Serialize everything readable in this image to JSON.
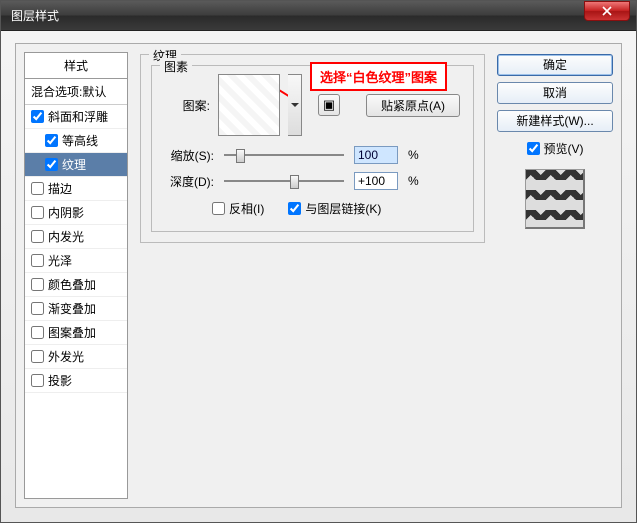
{
  "window": {
    "title": "图层样式"
  },
  "styles_panel": {
    "header": "样式",
    "blend_options": "混合选项:默认",
    "items": [
      {
        "label": "斜面和浮雕",
        "checked": true,
        "indent": false,
        "selected": false
      },
      {
        "label": "等高线",
        "checked": true,
        "indent": true,
        "selected": false
      },
      {
        "label": "纹理",
        "checked": true,
        "indent": true,
        "selected": true
      },
      {
        "label": "描边",
        "checked": false,
        "indent": false,
        "selected": false
      },
      {
        "label": "内阴影",
        "checked": false,
        "indent": false,
        "selected": false
      },
      {
        "label": "内发光",
        "checked": false,
        "indent": false,
        "selected": false
      },
      {
        "label": "光泽",
        "checked": false,
        "indent": false,
        "selected": false
      },
      {
        "label": "颜色叠加",
        "checked": false,
        "indent": false,
        "selected": false
      },
      {
        "label": "渐变叠加",
        "checked": false,
        "indent": false,
        "selected": false
      },
      {
        "label": "图案叠加",
        "checked": false,
        "indent": false,
        "selected": false
      },
      {
        "label": "外发光",
        "checked": false,
        "indent": false,
        "selected": false
      },
      {
        "label": "投影",
        "checked": false,
        "indent": false,
        "selected": false
      }
    ]
  },
  "main": {
    "section_title": "纹理",
    "element_title": "图素",
    "pattern_label": "图案:",
    "snap_origin": "贴紧原点(A)",
    "scale_label": "缩放(S):",
    "scale_value": "100",
    "depth_label": "深度(D):",
    "depth_value": "+100",
    "percent": "%",
    "invert_label": "反相(I)",
    "invert_checked": false,
    "link_label": "与图层链接(K)",
    "link_checked": true,
    "callout": "选择“白色纹理”图案"
  },
  "right": {
    "ok": "确定",
    "cancel": "取消",
    "new_style": "新建样式(W)...",
    "preview": "预览(V)",
    "preview_checked": true
  }
}
